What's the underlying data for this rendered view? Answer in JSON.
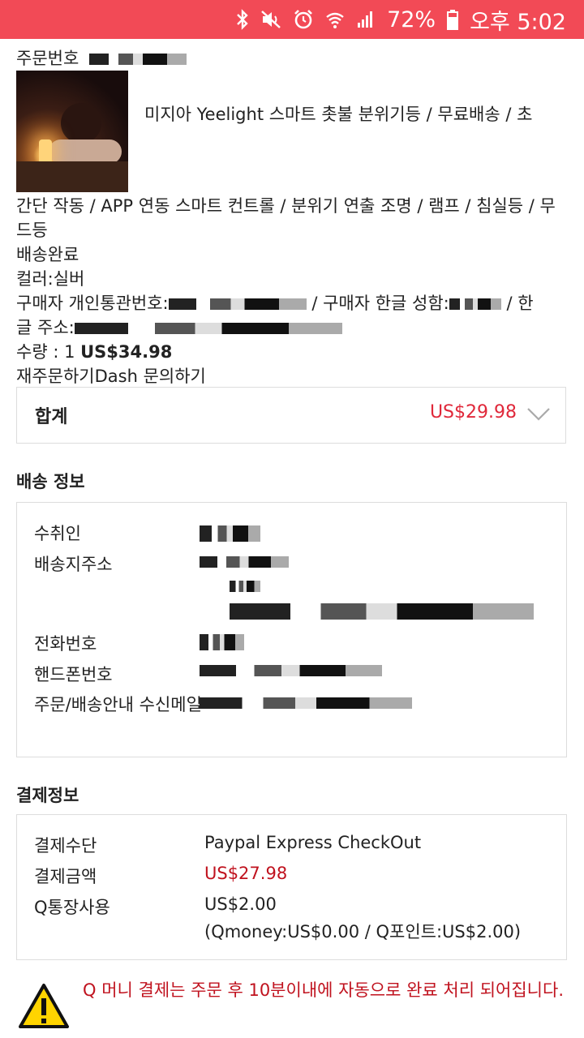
{
  "status_bar": {
    "battery": "72%",
    "time": "오후 5:02"
  },
  "order": {
    "number_label": "주문번호",
    "product_title": "미지아 Yeelight 스마트 촛불 분위기등 / 무료배송 / 초",
    "product_title_cont": "간단 작동 / APP 연동 스마트 컨트롤 / 분위기 연출 조명 / 램프 / 침실등 / 무드등",
    "status": "배송완료",
    "color": "컬러:실버",
    "customs_label": "구매자 개인통관번호:",
    "name_label": "/ 구매자 한글 성함:",
    "address_label": "/ 한글 주소:",
    "quantity": "수량 : 1",
    "price": "US$34.98",
    "reorder": "재주문하기",
    "dash": "Dash",
    "inquiry": "문의하기"
  },
  "total": {
    "label": "합계",
    "value": "US$29.98"
  },
  "shipping": {
    "title": "배송 정보",
    "recipient_label": "수취인",
    "address_label": "배송지주소",
    "phone_label": "전화번호",
    "mobile_label": "핸드폰번호",
    "notify_label": "주문/배송안내 수신메일"
  },
  "payment": {
    "title": "결제정보",
    "method_label": "결제수단",
    "method_value": "Paypal Express CheckOut",
    "amount_label": "결제금액",
    "amount_value": "US$27.98",
    "qbank_label": "Q통장사용",
    "qbank_value": "US$2.00",
    "qbank_detail": "(Qmoney:US$0.00 / Q포인트:US$2.00)"
  },
  "notice": "Q 머니 결제는 주문 후 10분이내에 자동으로 완료 처리 되어집니다.",
  "colors": {
    "statusbar": "#f24a56",
    "price_red": "#e0283a",
    "notice_red": "#c0121e"
  }
}
